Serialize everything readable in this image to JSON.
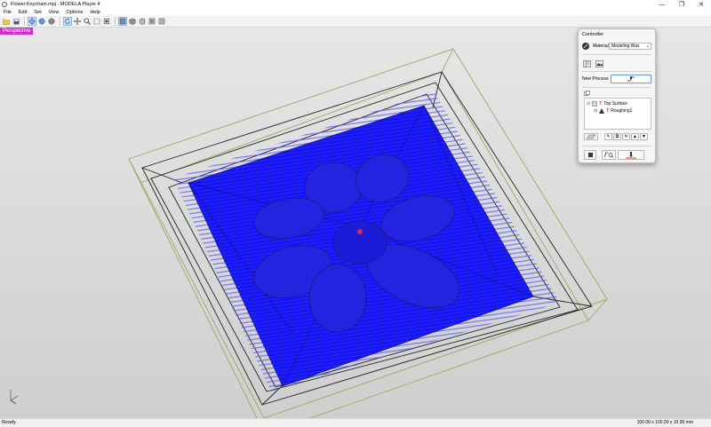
{
  "window": {
    "title": "Flower Keychain.mpj - MODELA Player 4",
    "controls": [
      "—",
      "❐",
      "✕"
    ]
  },
  "menu": [
    {
      "label": "File"
    },
    {
      "label": "Edit"
    },
    {
      "label": "Set"
    },
    {
      "label": "View"
    },
    {
      "label": "Options"
    },
    {
      "label": "Help"
    }
  ],
  "viewport": {
    "label": "Perspective",
    "label_color": "#d02fd0",
    "toolpath_color": "#1a1aff"
  },
  "controller": {
    "title": "Controller",
    "material_label": "Material",
    "material_value": "Modeling Wax",
    "new_process_label": "New Process",
    "tree": {
      "root": "Top Surface",
      "child": "Roughing1"
    }
  },
  "status": {
    "left": "Ready",
    "right": "100.00 x 100.00 x 10.00 mm"
  }
}
